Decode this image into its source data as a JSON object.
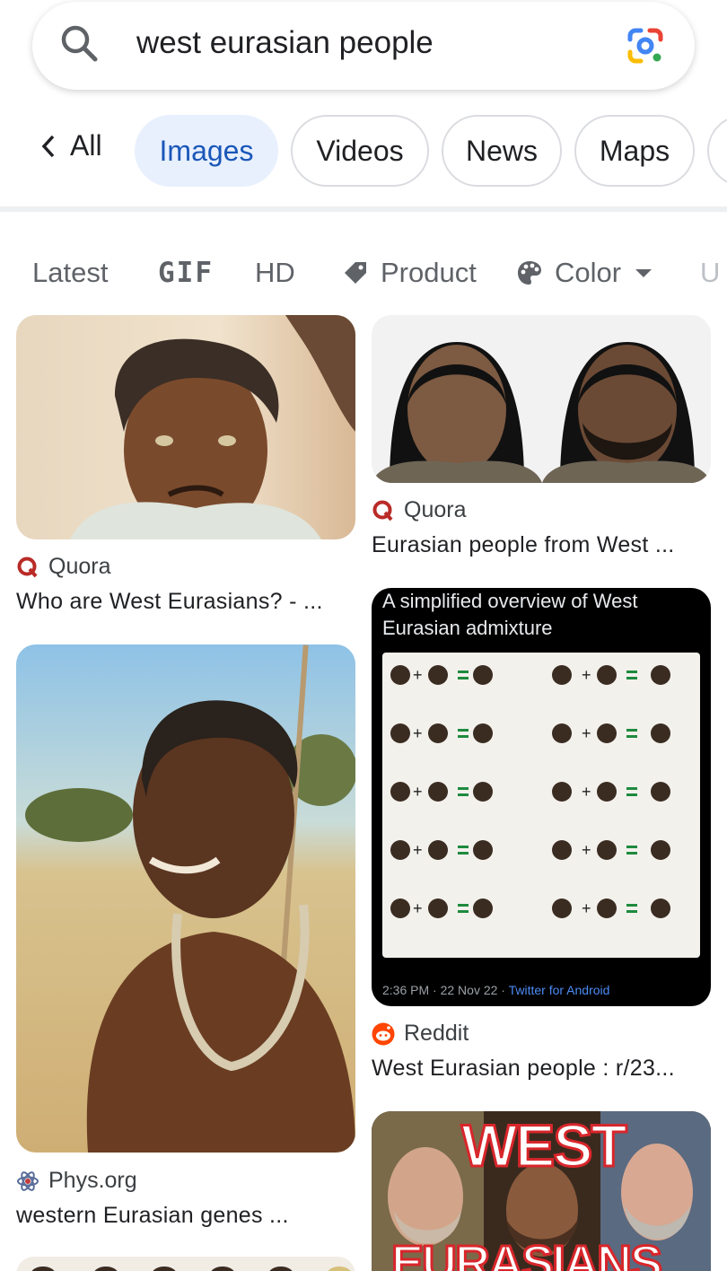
{
  "search": {
    "query": "west eurasian people"
  },
  "tabs": {
    "back_label": "All",
    "items": [
      {
        "label": "Images",
        "active": true
      },
      {
        "label": "Videos",
        "active": false
      },
      {
        "label": "News",
        "active": false
      },
      {
        "label": "Maps",
        "active": false
      }
    ]
  },
  "filters": [
    "Latest",
    "GIF",
    "HD",
    "Product",
    "Color",
    "U"
  ],
  "results": [
    {
      "source": "Quora",
      "caption": "Who are West Eurasians? - ..."
    },
    {
      "source": "Quora",
      "caption": "Eurasian people from West ..."
    },
    {
      "source": "Reddit",
      "caption": "West Eurasian people : r/23..."
    },
    {
      "source": "Phys.org",
      "caption": "western Eurasian genes ..."
    }
  ],
  "poster": {
    "title_line1": "A simplified overview of West",
    "title_line2": "Eurasian admixture",
    "footer_time": "2:36 PM · 22 Nov 22 · ",
    "footer_app": "Twitter for Android"
  },
  "west_banner": {
    "line1": "WEST",
    "line2": "EURASIANS"
  },
  "colors": {
    "active_chip_bg": "#e8f0fe",
    "active_chip_text": "#1a57b8",
    "quora_red": "#b92b27",
    "reddit_orange": "#ff4500"
  }
}
